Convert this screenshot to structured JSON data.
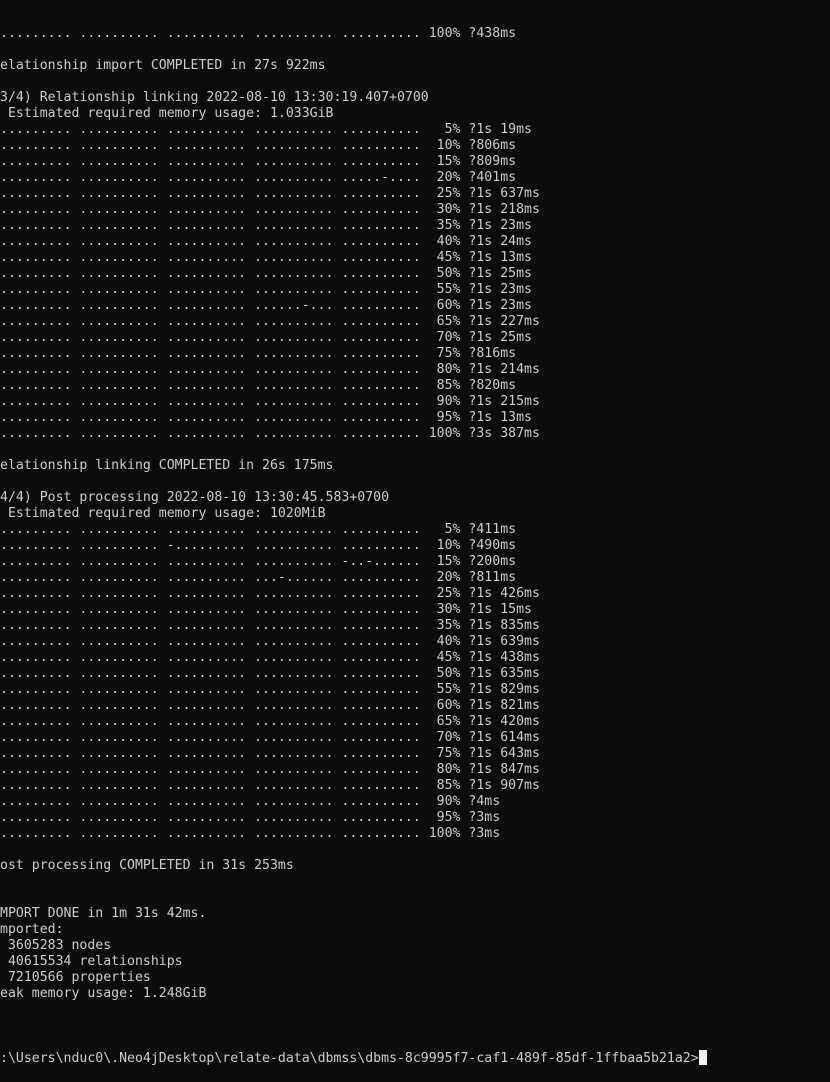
{
  "terminal": {
    "lines": [
      "......... .......... .......... .......... .......... 100% ?438ms",
      "",
      "elationship import COMPLETED in 27s 922ms",
      "",
      "3/4) Relationship linking 2022-08-10 13:30:19.407+0700",
      " Estimated required memory usage: 1.033GiB",
      "......... .......... .......... .......... ..........   5% ?1s 19ms",
      "......... .......... .......... .......... ..........  10% ?806ms",
      "......... .......... .......... .......... ..........  15% ?809ms",
      "......... .......... .......... .......... .....-....  20% ?401ms",
      "......... .......... .......... .......... ..........  25% ?1s 637ms",
      "......... .......... .......... .......... ..........  30% ?1s 218ms",
      "......... .......... .......... .......... ..........  35% ?1s 23ms",
      "......... .......... .......... .......... ..........  40% ?1s 24ms",
      "......... .......... .......... .......... ..........  45% ?1s 13ms",
      "......... .......... .......... .......... ..........  50% ?1s 25ms",
      "......... .......... .......... .......... ..........  55% ?1s 23ms",
      "......... .......... .......... ......-... ..........  60% ?1s 23ms",
      "......... .......... .......... .......... ..........  65% ?1s 227ms",
      "......... .......... .......... .......... ..........  70% ?1s 25ms",
      "......... .......... .......... .......... ..........  75% ?816ms",
      "......... .......... .......... .......... ..........  80% ?1s 214ms",
      "......... .......... .......... .......... ..........  85% ?820ms",
      "......... .......... .......... .......... ..........  90% ?1s 215ms",
      "......... .......... .......... .......... ..........  95% ?1s 13ms",
      "......... .......... .......... .......... .......... 100% ?3s 387ms",
      "",
      "elationship linking COMPLETED in 26s 175ms",
      "",
      "4/4) Post processing 2022-08-10 13:30:45.583+0700",
      " Estimated required memory usage: 1020MiB",
      "......... .......... .......... .......... ..........   5% ?411ms",
      "......... .......... -......... .......... ..........  10% ?490ms",
      "......... .......... .......... .......... -..-......  15% ?200ms",
      "......... .......... .......... ...-...... ..........  20% ?811ms",
      "......... .......... .......... .......... ..........  25% ?1s 426ms",
      "......... .......... .......... .......... ..........  30% ?1s 15ms",
      "......... .......... .......... .......... ..........  35% ?1s 835ms",
      "......... .......... .......... .......... ..........  40% ?1s 639ms",
      "......... .......... .......... .......... ..........  45% ?1s 438ms",
      "......... .......... .......... .......... ..........  50% ?1s 635ms",
      "......... .......... .......... .......... ..........  55% ?1s 829ms",
      "......... .......... .......... .......... ..........  60% ?1s 821ms",
      "......... .......... .......... .......... ..........  65% ?1s 420ms",
      "......... .......... .......... .......... ..........  70% ?1s 614ms",
      "......... .......... .......... .......... ..........  75% ?1s 643ms",
      "......... .......... .......... .......... ..........  80% ?1s 847ms",
      "......... .......... .......... .......... ..........  85% ?1s 907ms",
      "......... .......... .......... .......... ..........  90% ?4ms",
      "......... .......... .......... .......... ..........  95% ?3ms",
      "......... .......... .......... .......... .......... 100% ?3ms",
      "",
      "ost processing COMPLETED in 31s 253ms",
      "",
      "",
      "MPORT DONE in 1m 31s 42ms.",
      "mported:",
      " 3605283 nodes",
      " 40615534 relationships",
      " 7210566 properties",
      "eak memory usage: 1.248GiB",
      ""
    ],
    "prompt": ":\\Users\\nduc0\\.Neo4jDesktop\\relate-data\\dbmss\\dbms-8c9995f7-caf1-489f-85df-1ffbaa5b21a2>",
    "colors": {
      "background": "#0c0c0c",
      "text": "#cccccc",
      "cursor": "#f2f2f2"
    }
  }
}
